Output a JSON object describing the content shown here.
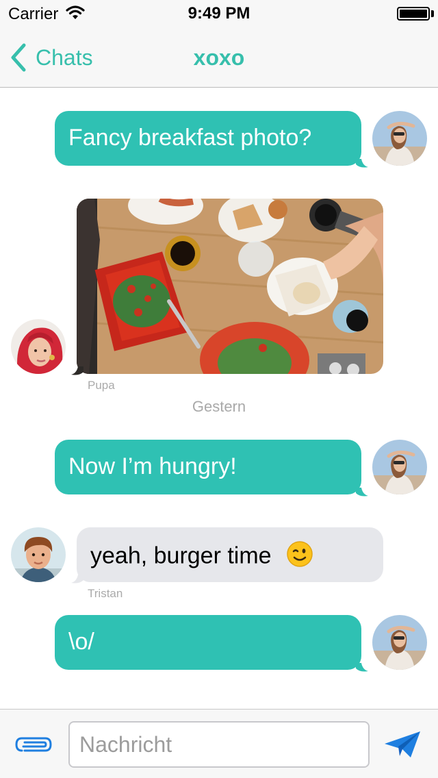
{
  "status_bar": {
    "carrier": "Carrier",
    "time": "9:49 PM"
  },
  "nav": {
    "back_label": "Chats",
    "title": "xoxo"
  },
  "messages": [
    {
      "direction": "outgoing",
      "text": "Fancy breakfast photo?"
    },
    {
      "direction": "incoming",
      "kind": "photo",
      "sender": "Pupa"
    },
    {
      "kind": "timestamp",
      "text": "Gestern"
    },
    {
      "direction": "outgoing",
      "text": "Now I’m hungry!"
    },
    {
      "direction": "incoming",
      "text": "yeah, burger time",
      "emoji": "winking-face",
      "sender": "Tristan"
    },
    {
      "direction": "outgoing",
      "text": "\\o/"
    }
  ],
  "input": {
    "placeholder": "Nachricht",
    "value": ""
  },
  "icons": {
    "back": "chevron-left-icon",
    "attach": "paperclip-icon",
    "send": "paper-plane-icon",
    "wifi": "wifi-icon",
    "battery": "battery-icon"
  },
  "colors": {
    "accent": "#37bfac",
    "outgoing_bubble": "#2fc1b3",
    "incoming_bubble": "#e6e7eb",
    "send_icon": "#1f7fe0"
  }
}
